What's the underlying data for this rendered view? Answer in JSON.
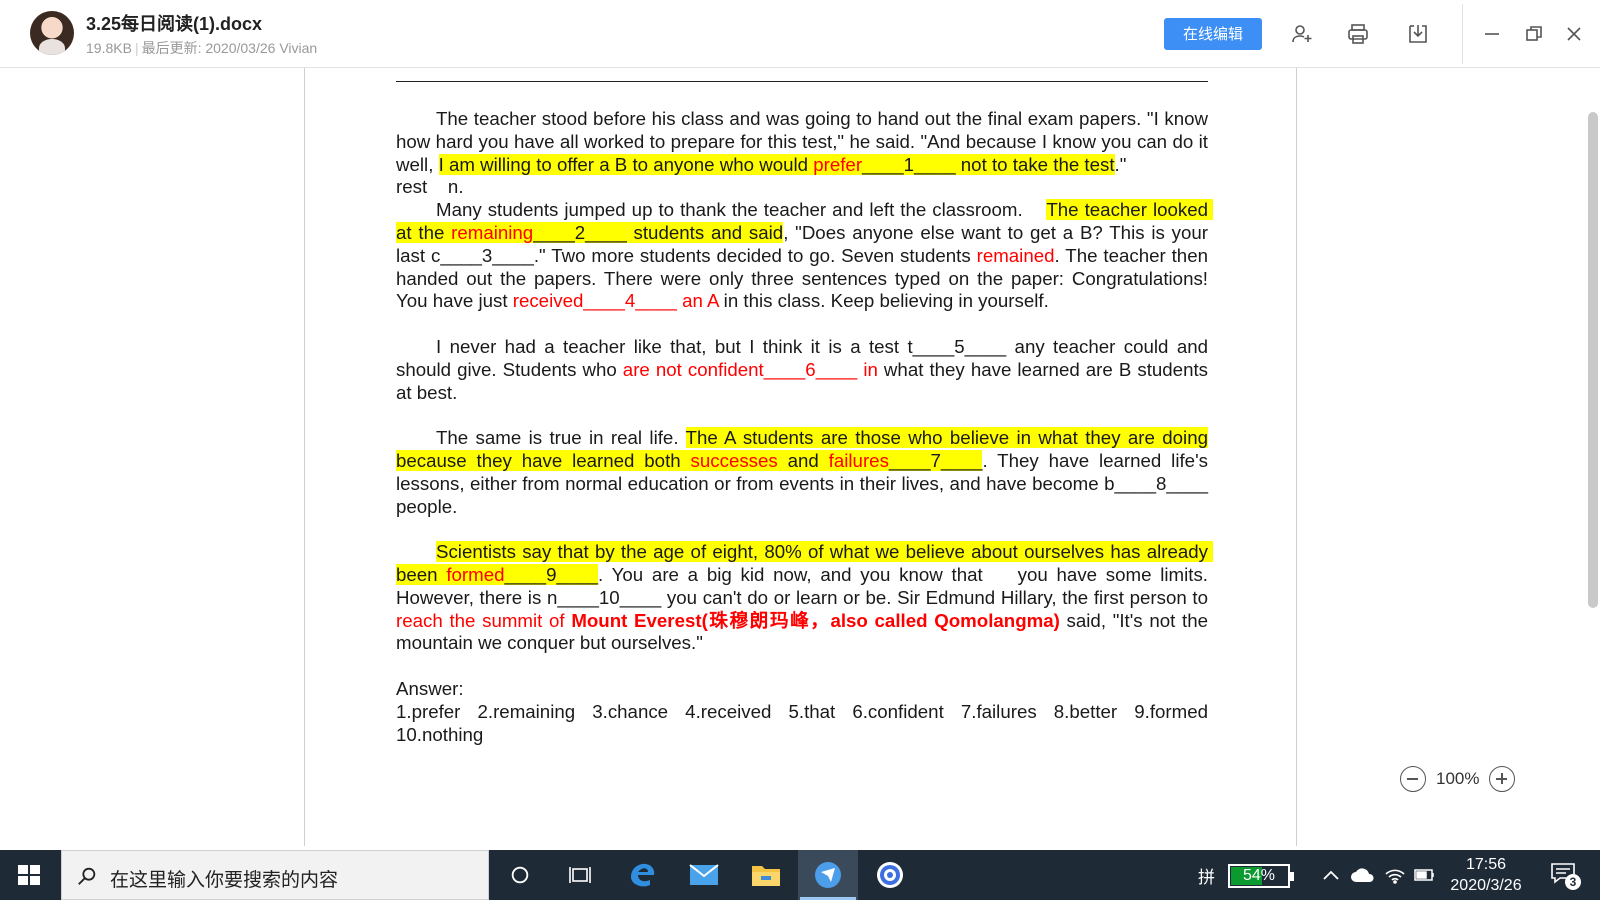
{
  "header": {
    "file_name": "3.25每日阅读(1).docx",
    "file_size": "19.8KB",
    "separator": "|",
    "last_updated": "最后更新: 2020/03/26 Vivian",
    "edit_online_label": "在线编辑",
    "icons": [
      "add-collaborator-icon",
      "print-icon",
      "download-icon",
      "minimize-icon",
      "restore-icon",
      "close-icon"
    ]
  },
  "document": {
    "p1": {
      "t1": "The teacher stood before his class and was going to hand out the final exam papers. \"I know how hard you have all worked to prepare for this test,\" he said. \"And because I know you can do it well, ",
      "hl1": "I am willing to offer a B to anyone who would ",
      "hl_red": "prefer",
      "hl2": "____1____ not to take the test",
      "t2": ".\""
    },
    "note": "rest    n.",
    "p2": {
      "t1": "Many students jumped up to thank the teacher and left the classroom.    ",
      "hl1": "The teacher looked at the ",
      "hl_red": "remaining",
      "hl2": "____2____ students and said",
      "t2": ", \"Does anyone else want to get a B? This is your last c____3____.\" Two more students decided to go. Seven students ",
      "red1": "remained",
      "t3": ". The teacher then handed out the papers. There were only three sentences typed on the paper: Congratulations! You have just ",
      "red2": "received____4____ an A",
      "t4": " in this class. Keep believing in yourself."
    },
    "p3": {
      "t1": "I never had a teacher like that, but I think it is a test t____5____ any teacher could and should give. Students who ",
      "red1": "are not confident____6____ in",
      "t2": " what they have learned are B students at best."
    },
    "p4": {
      "t1": "The same is true in real life. ",
      "hl1": "The A students are those who believe in what they are doing because they have learned both ",
      "hl_red1": "successes",
      "hl2": " and ",
      "hl_red2": "failures",
      "hl3": "____7____",
      "t2": ". They have learned life's lessons, either from normal education or from events in their lives, and have become b____8____ people."
    },
    "p5": {
      "hl1": "Scientists say that by the age of eight, 80% of what we believe about ourselves has already been ",
      "hl_red": "formed",
      "hl2": "____9____",
      "t1": ". You are a big kid now, and you know that    you have some limits. However, there is n____10____ you can't do or learn or be. Sir Edmund Hillary, the first person to ",
      "red1": "reach the summit of ",
      "red_bold": "Mount Everest(珠穆朗玛峰，also called Qomolangma)",
      "t2": " said, \"It's not the mountain we conquer but ourselves.\""
    },
    "answer_label": "Answer:",
    "answers": "1.prefer  2.remaining  3.chance  4.received  5.that  6.confident  7.failures  8.better  9.formed 10.nothing"
  },
  "zoom": {
    "value": "100%"
  },
  "taskbar": {
    "search_placeholder": "在这里输入你要搜索的内容",
    "ime": "拼",
    "battery": "54%",
    "battery_level": 0.54,
    "time": "17:56",
    "date": "2020/3/26",
    "notifications": "3"
  },
  "colors": {
    "accent": "#3d8ff5",
    "highlight": "#ffff00",
    "red_text": "#ff0000",
    "taskbar": "#1f2a37"
  }
}
